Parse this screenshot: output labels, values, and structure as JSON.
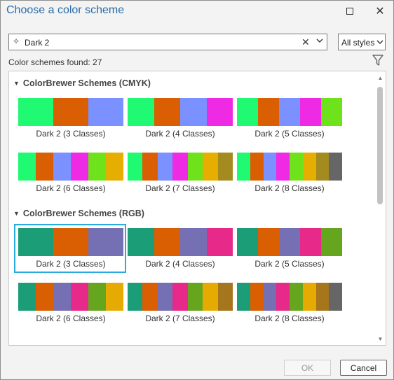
{
  "window": {
    "title": "Choose a color scheme",
    "maximize_icon": "maximize-icon",
    "close_icon": "close-icon",
    "close_glyph": "✕"
  },
  "search": {
    "value": "Dark 2",
    "icon": "sparkle-search-icon",
    "icon_glyph": "✧",
    "clear_glyph": "✕"
  },
  "style_filter": {
    "selected": "All styles"
  },
  "results": {
    "count_text": "Color schemes found: 27",
    "filter_icon": "funnel-filter-icon"
  },
  "groups": [
    {
      "title": "ColorBrewer Schemes (CMYK)",
      "schemes": [
        {
          "label": "Dark 2 (3 Classes)",
          "colors": [
            "#20fa72",
            "#d95f02",
            "#7a91ff"
          ]
        },
        {
          "label": "Dark 2 (4 Classes)",
          "colors": [
            "#20fa72",
            "#d95f02",
            "#7a91ff",
            "#ef2ae4"
          ]
        },
        {
          "label": "Dark 2 (5 Classes)",
          "colors": [
            "#20fa72",
            "#d95f02",
            "#7a91ff",
            "#ef2ae4",
            "#6ee21b"
          ]
        },
        {
          "label": "Dark 2 (6 Classes)",
          "colors": [
            "#20fa72",
            "#d95f02",
            "#7a91ff",
            "#ef2ae4",
            "#6ee21b",
            "#e5ae00"
          ]
        },
        {
          "label": "Dark 2 (7 Classes)",
          "colors": [
            "#20fa72",
            "#d95f02",
            "#7a91ff",
            "#ef2ae4",
            "#6ee21b",
            "#e5ae00",
            "#a48b1f"
          ]
        },
        {
          "label": "Dark 2 (8 Classes)",
          "colors": [
            "#20fa72",
            "#d95f02",
            "#7a91ff",
            "#ef2ae4",
            "#6ee21b",
            "#e5ae00",
            "#a48b1f",
            "#666666"
          ]
        }
      ]
    },
    {
      "title": "ColorBrewer Schemes (RGB)",
      "schemes": [
        {
          "label": "Dark 2 (3 Classes)",
          "colors": [
            "#1b9e77",
            "#d95f02",
            "#7570b3"
          ],
          "selected": true
        },
        {
          "label": "Dark 2 (4 Classes)",
          "colors": [
            "#1b9e77",
            "#d95f02",
            "#7570b3",
            "#e7298a"
          ]
        },
        {
          "label": "Dark 2 (5 Classes)",
          "colors": [
            "#1b9e77",
            "#d95f02",
            "#7570b3",
            "#e7298a",
            "#66a61e"
          ]
        },
        {
          "label": "Dark 2 (6 Classes)",
          "colors": [
            "#1b9e77",
            "#d95f02",
            "#7570b3",
            "#e7298a",
            "#66a61e",
            "#e6ab02"
          ]
        },
        {
          "label": "Dark 2 (7 Classes)",
          "colors": [
            "#1b9e77",
            "#d95f02",
            "#7570b3",
            "#e7298a",
            "#66a61e",
            "#e6ab02",
            "#a6761d"
          ]
        },
        {
          "label": "Dark 2 (8 Classes)",
          "colors": [
            "#1b9e77",
            "#d95f02",
            "#7570b3",
            "#e7298a",
            "#66a61e",
            "#e6ab02",
            "#a6761d",
            "#666666"
          ]
        }
      ]
    }
  ],
  "buttons": {
    "ok": "OK",
    "cancel": "Cancel"
  },
  "colors": {
    "title": "#2a6ca8",
    "selection": "#29abe2"
  }
}
